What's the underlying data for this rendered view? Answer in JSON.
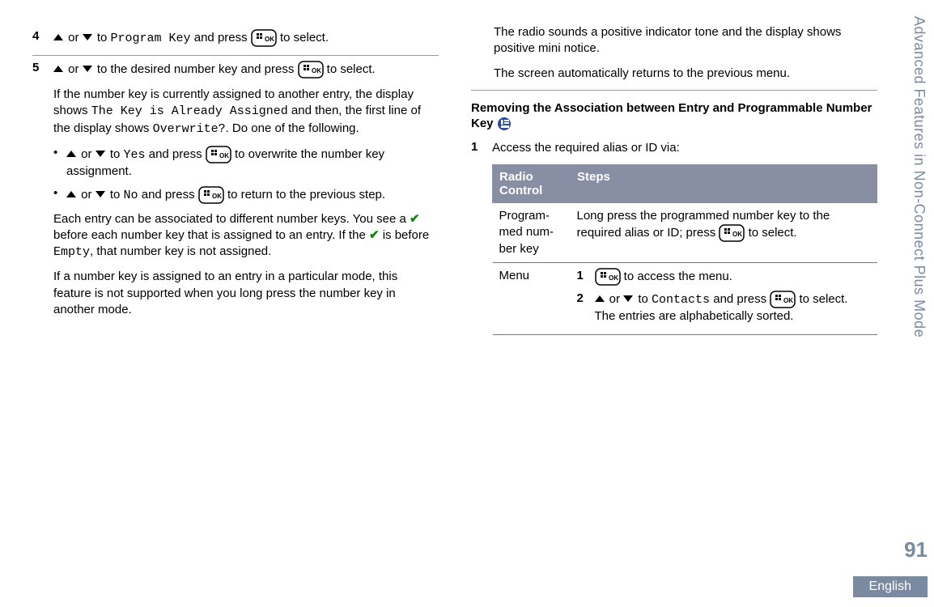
{
  "sidebar_title": "Advanced Features in Non-Connect Plus Mode",
  "page_number": "91",
  "language": "English",
  "left": {
    "step4": {
      "num": "4",
      "line": {
        "pre": " or ",
        "mid": " to ",
        "program_key": "Program Key",
        "post": " and press ",
        "end": " to select."
      }
    },
    "step5": {
      "num": "5",
      "line1": {
        "pre": " or ",
        "mid": " to the desired number key and press ",
        "end": " to select."
      },
      "para1a": "If the number key is currently assigned to another entry, the display shows ",
      "para1_code1": "The Key is Already Assigned",
      "para1b": " and then, the first line of the display shows ",
      "para1_code2": "Overwrite?",
      "para1c": ". Do one of the following.",
      "bullet1": {
        "pre": " or ",
        "mid": " to ",
        "yes": "Yes",
        "post": " and press ",
        "end": " to overwrite the number key assignment."
      },
      "bullet2": {
        "pre": " or ",
        "mid": " to ",
        "no": "No",
        "post": " and press ",
        "end": " to return to the previous step."
      },
      "para2a": "Each entry can be associated to different number keys. You see a ",
      "para2b": " before each number key that is assigned to an entry. If the ",
      "para2c": " is before ",
      "para2_empty": "Empty",
      "para2d": ", that number key is not assigned.",
      "para3": "If a number key is assigned to an entry in a particular mode, this feature is not supported when you long press the number key in another mode."
    }
  },
  "right": {
    "top_para1": "The radio sounds a positive indicator tone and the display shows positive mini notice.",
    "top_para2": "The screen automatically returns to the previous menu.",
    "heading": "Removing the Association between Entry and Programmable Number Key",
    "step1": {
      "num": "1",
      "text": "Access the required alias or ID via:"
    },
    "table": {
      "head1": "Radio Control",
      "head2": "Steps",
      "row1": {
        "c1": "Program­med num­ber key",
        "c2a": "Long press the programmed number key to the required alias or ID; press ",
        "c2b": " to select."
      },
      "row2": {
        "c1": "Menu",
        "s1": {
          "n": "1",
          "t1": " to access the menu."
        },
        "s2": {
          "n": "2",
          "t_pre": " or ",
          "t_mid": " to ",
          "contacts": "Contacts",
          "t_post": " and press ",
          "t_end": " to select. The entries are al­phabetically sorted."
        }
      }
    }
  }
}
